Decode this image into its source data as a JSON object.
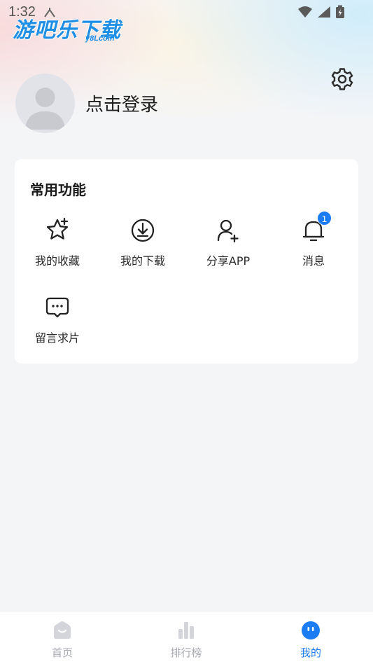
{
  "status_bar": {
    "time": "1:32"
  },
  "watermark": {
    "logo_text": "游吧乐下载",
    "logo_sub": "y8Lcom"
  },
  "profile": {
    "login_label": "点击登录"
  },
  "common_functions": {
    "title": "常用功能",
    "items": [
      {
        "label": "我的收藏",
        "icon": "star-plus-icon"
      },
      {
        "label": "我的下载",
        "icon": "download-icon"
      },
      {
        "label": "分享APP",
        "icon": "add-user-icon"
      },
      {
        "label": "消息",
        "icon": "bell-icon",
        "badge": "1"
      },
      {
        "label": "留言求片",
        "icon": "chat-bubble-icon"
      }
    ]
  },
  "tabbar": {
    "tabs": [
      {
        "label": "首页",
        "icon": "home-icon",
        "active": false
      },
      {
        "label": "排行榜",
        "icon": "chart-bars-icon",
        "active": false
      },
      {
        "label": "我的",
        "icon": "profile-face-icon",
        "active": true
      }
    ]
  },
  "colors": {
    "accent": "#1b7cf4",
    "inactive": "#a7a9b0",
    "background": "#f4f5f7"
  }
}
